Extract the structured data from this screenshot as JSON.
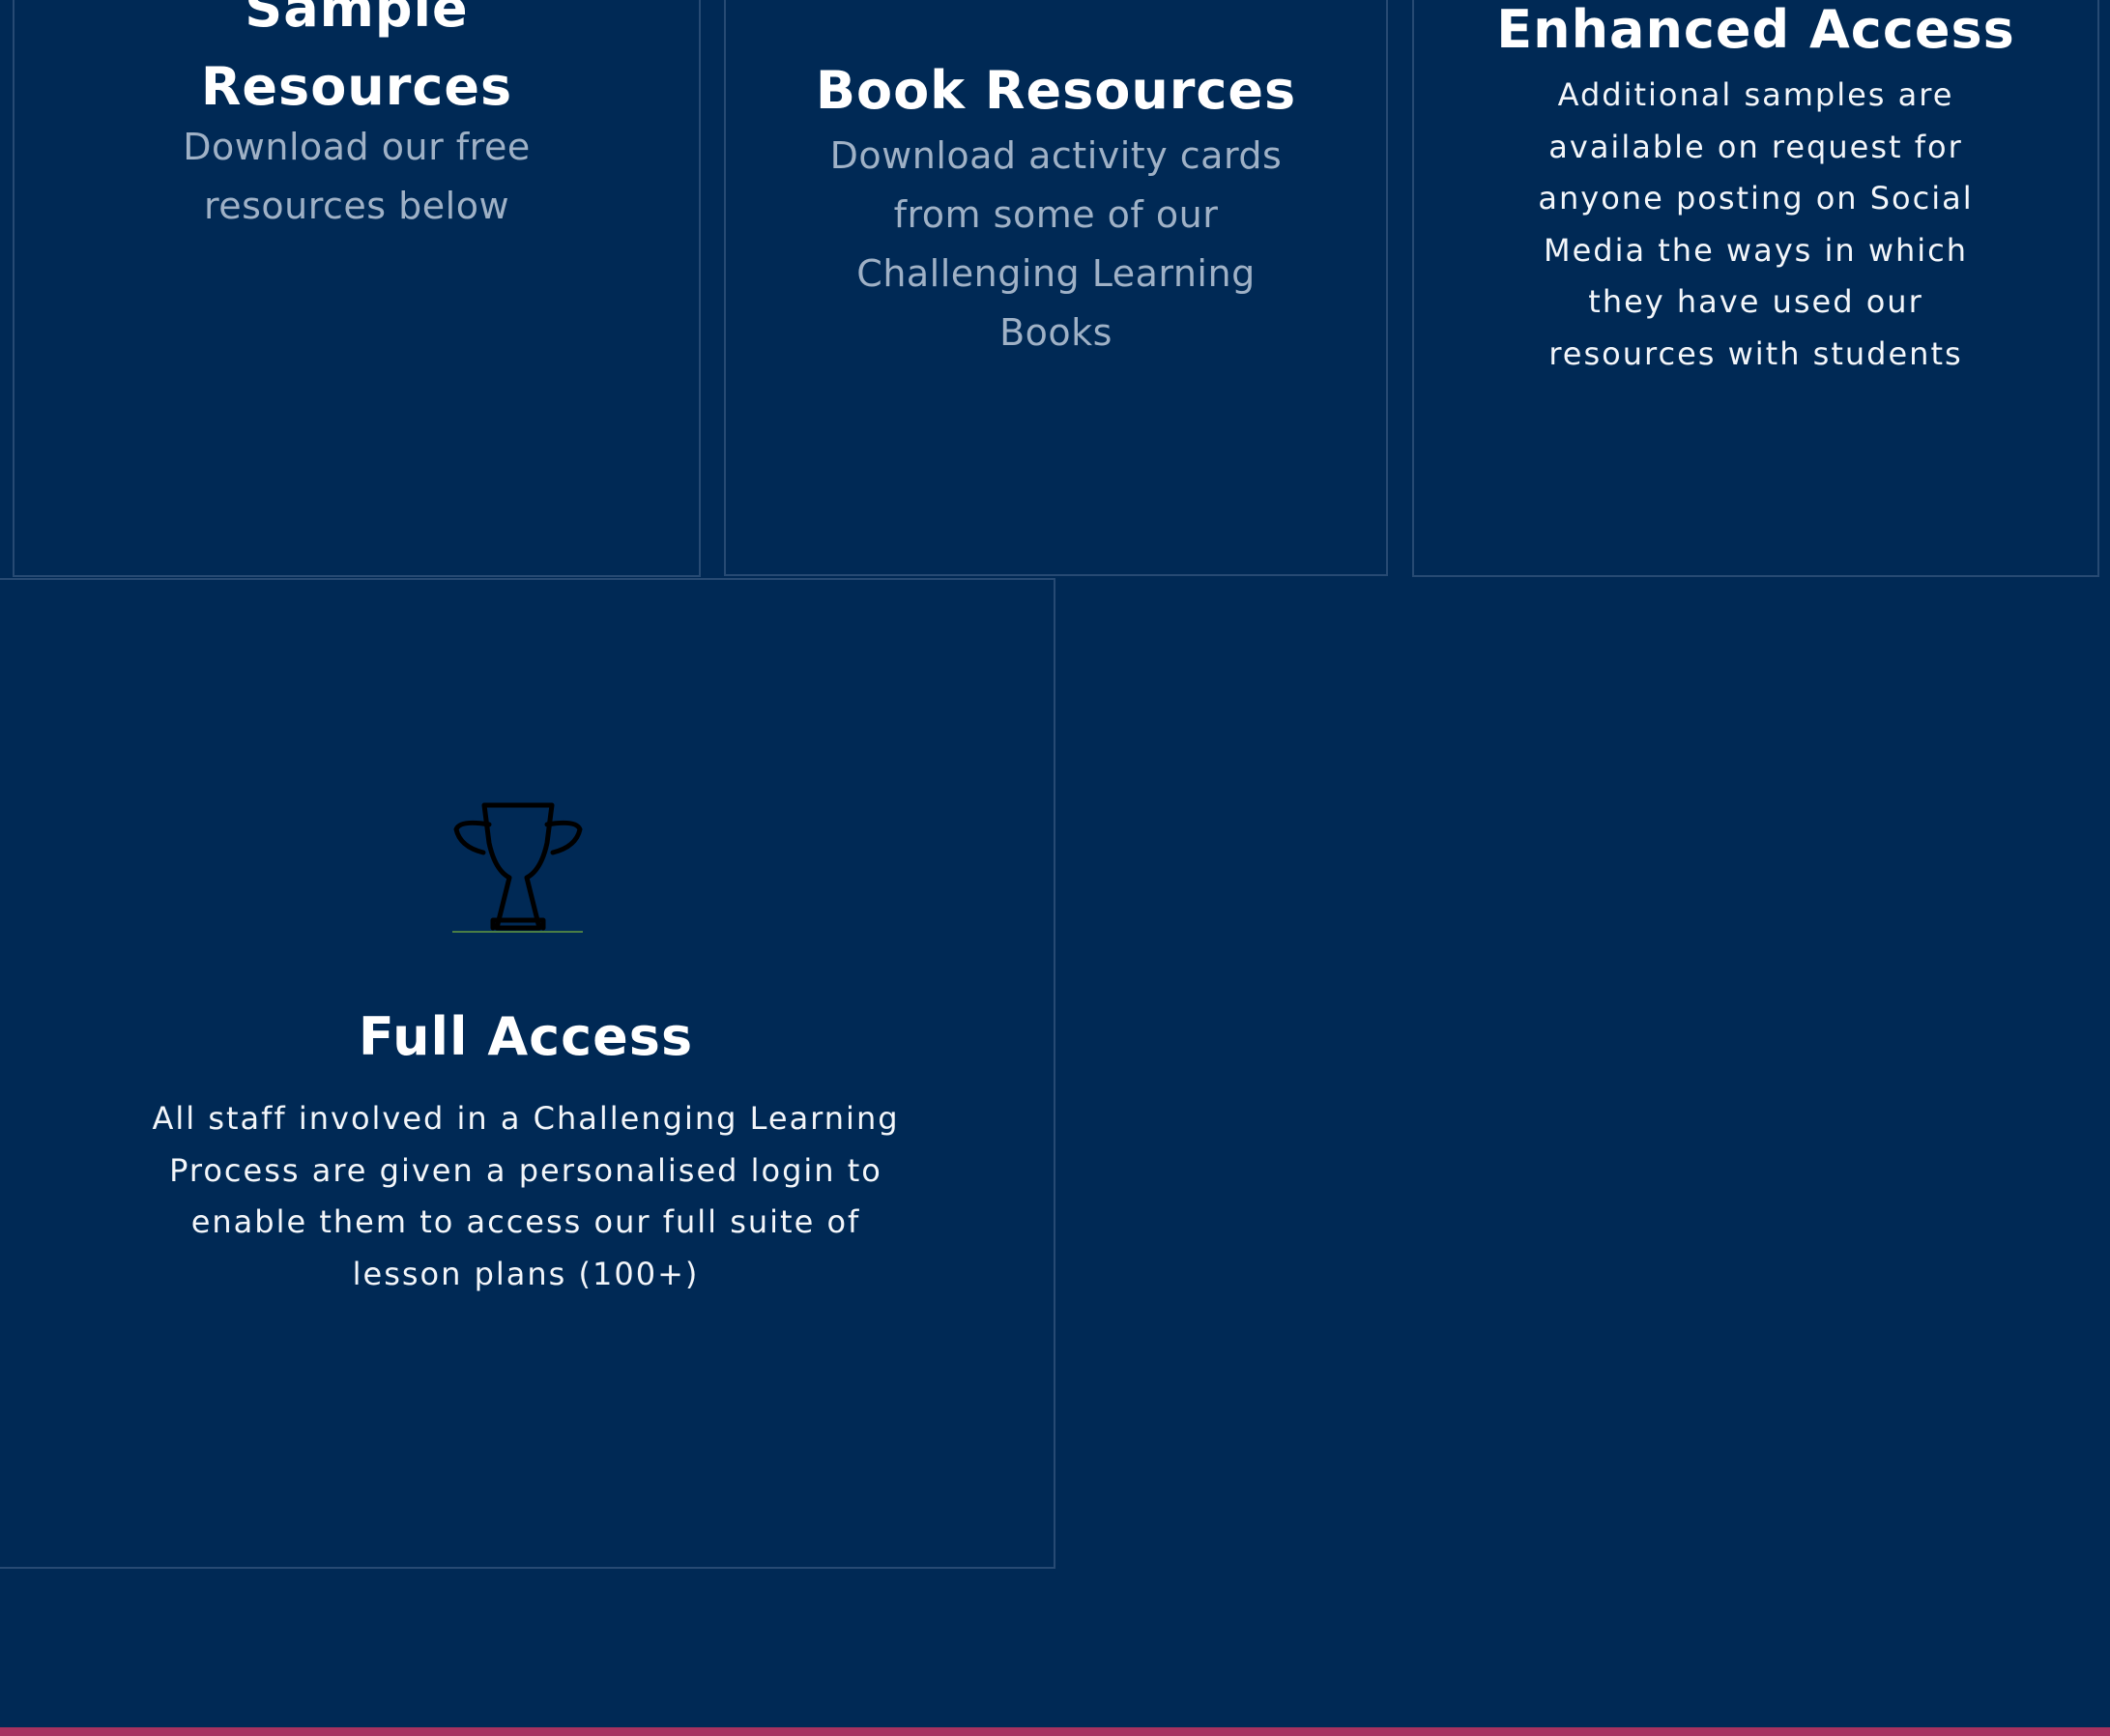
{
  "cards": {
    "sample": {
      "title_line1": "Sample",
      "title_line2": "Resources",
      "desc_line1": "Download our free",
      "desc_line2": "resources below"
    },
    "book": {
      "title": "Book Resources",
      "desc_lines": [
        "Download activity cards",
        "from some of our",
        "Challenging Learning",
        "Books"
      ]
    },
    "enhanced": {
      "title": "Enhanced Access",
      "desc_lines": [
        "Additional samples are",
        "available on request for",
        "anyone posting on Social",
        "Media the ways in which",
        "they have used our",
        "resources with students"
      ]
    },
    "full": {
      "icon": "trophy-icon",
      "title": "Full Access",
      "desc_lines": [
        "All staff involved in a Challenging Learning",
        "Process are given a personalised login to",
        "enable them to access our full suite of",
        "lesson plans (100+)"
      ]
    }
  },
  "colors": {
    "background": "#002955",
    "card_border": "#274a73",
    "muted_text": "#9fb1c6",
    "accent_bar": "#a6325f"
  }
}
